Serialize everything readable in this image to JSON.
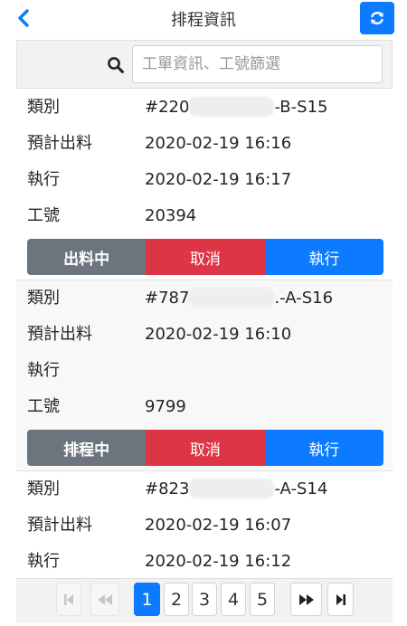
{
  "header": {
    "title": "排程資訊",
    "back_icon": "chevron-left-icon",
    "refresh_icon": "refresh-icon",
    "accent_color": "#0d7bff"
  },
  "search": {
    "placeholder": "工單資訊、工號篩選",
    "value": "",
    "icon": "search-icon"
  },
  "labels": {
    "category": "類別",
    "planned": "預計出料",
    "executed": "執行",
    "worker_id": "工號"
  },
  "cards": [
    {
      "category_prefix": "#220",
      "category_suffix": "-B-S15",
      "planned": "2020-02-19 16:16",
      "executed": "2020-02-19 16:17",
      "worker_id": "20394",
      "status_label": "出料中",
      "cancel_label": "取消",
      "exec_label": "執行"
    },
    {
      "category_prefix": "#787",
      "category_suffix": ".-A-S16",
      "planned": "2020-02-19 16:10",
      "executed": "",
      "worker_id": "9799",
      "status_label": "排程中",
      "cancel_label": "取消",
      "exec_label": "執行"
    },
    {
      "category_prefix": "#823",
      "category_suffix": "-A-S14",
      "planned": "2020-02-19 16:07",
      "executed": "2020-02-19 16:12"
    }
  ],
  "pagination": {
    "pages": [
      "1",
      "2",
      "3",
      "4",
      "5"
    ],
    "current_page": "1",
    "first_icon": "first-page-icon",
    "prev_icon": "prev-page-icon",
    "next_icon": "next-page-icon",
    "last_icon": "last-page-icon"
  }
}
